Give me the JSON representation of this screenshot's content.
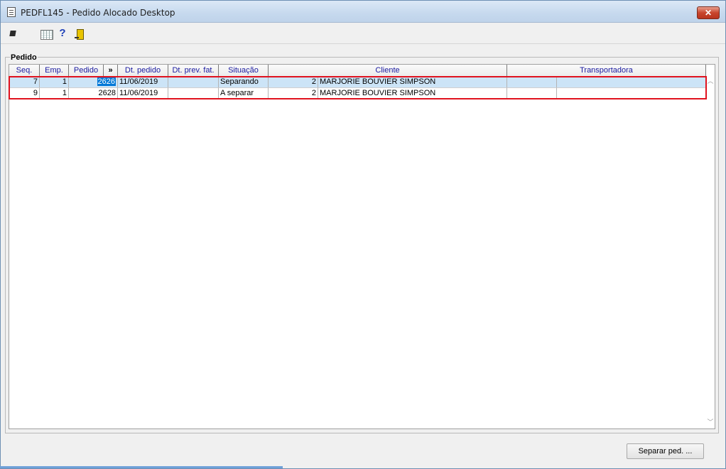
{
  "window": {
    "title": "PEDFL145 - Pedido Alocado Desktop",
    "close_label": "✕",
    "title_icon": "document-icon"
  },
  "toolbar": {
    "icons": [
      "arrow-icon",
      "calculator-icon",
      "help-icon",
      "exit-door-icon"
    ],
    "help_label": "?"
  },
  "group": {
    "label": "Pedido"
  },
  "grid": {
    "columns": [
      "Seq.",
      "Emp.",
      "Pedido",
      "»",
      "Dt. pedido",
      "Dt. prev. fat.",
      "Situação",
      "Cliente",
      "Transportadora"
    ],
    "rows": [
      {
        "seq": "7",
        "emp": "1",
        "pedido": "2626",
        "dt_pedido": "11/06/2019",
        "dt_prev_fat": "",
        "situacao": "Separando",
        "cliente_cod": "2",
        "cliente_nome": "MARJORIE BOUVIER SIMPSON",
        "transp_cod": "",
        "transp_nome": ""
      },
      {
        "seq": "9",
        "emp": "1",
        "pedido": "2628",
        "dt_pedido": "11/06/2019",
        "dt_prev_fat": "",
        "situacao": "A separar",
        "cliente_cod": "2",
        "cliente_nome": "MARJORIE BOUVIER SIMPSON",
        "transp_cod": "",
        "transp_nome": ""
      }
    ],
    "scroll_up": "︿",
    "scroll_down": "﹀"
  },
  "actions": {
    "separar_label": "Separar ped. ..."
  },
  "colors": {
    "selected_row": "#cce4f7",
    "highlight": "#0078d7",
    "annotation_box": "#e0121e",
    "header_text": "#1a1aa0"
  }
}
